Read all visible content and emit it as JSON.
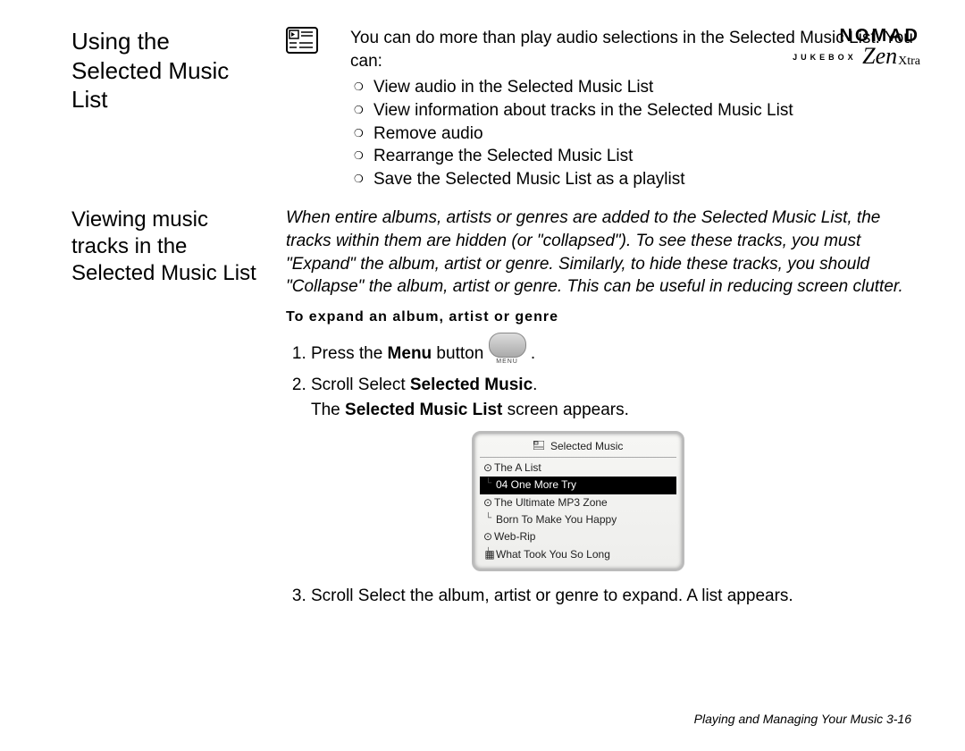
{
  "brand": {
    "nomad": "NOMAD",
    "jukebox": "JUKEBOX",
    "zen": "Zen",
    "xtra": "Xtra"
  },
  "section1": {
    "heading": "Using the Selected Music List",
    "intro": "You can do more than play audio selections in the Selected Music List. You can:",
    "bullets": [
      "View audio in the Selected Music List",
      "View information about tracks in the Selected Music List",
      "Remove audio",
      "Rearrange the Selected Music List",
      "Save the Selected Music List as a playlist"
    ]
  },
  "section2": {
    "heading": "Viewing music tracks in the Selected Music List",
    "paragraph": "When entire albums, artists or genres are added to the Selected Music List, the tracks within them are hidden (or \"collapsed\"). To see these tracks, you must \"Expand\" the album, artist or genre. Similarly, to hide these tracks, you should \"Collapse\" the album, artist or genre. This can be useful in reducing screen clutter.",
    "subhead": "To expand an album, artist or genre",
    "steps": {
      "s1_a": "Press the ",
      "s1_b": "Menu",
      "s1_c": " button ",
      "s1_d": ".",
      "s2_a": "Scroll Select ",
      "s2_b": "Selected Music",
      "s2_c": ".",
      "s2_line2_a": "The ",
      "s2_line2_b": "Selected Music List",
      "s2_line2_c": " screen appears.",
      "s3": "Scroll Select the album, artist or genre to expand. A list appears."
    },
    "menu_label": "MENU"
  },
  "device": {
    "title": "Selected Music",
    "items": [
      {
        "text": "The A List",
        "prefix": "⊙",
        "sub": false,
        "selected": false
      },
      {
        "text": "04 One More Try",
        "prefix": "",
        "sub": true,
        "selected": true
      },
      {
        "text": "The Ultimate MP3 Zone",
        "prefix": "⊙",
        "sub": false,
        "selected": false
      },
      {
        "text": "Born To Make You Happy",
        "prefix": "",
        "sub": true,
        "selected": false
      },
      {
        "text": "Web-Rip",
        "prefix": "⊙",
        "sub": false,
        "selected": false
      },
      {
        "text": "What Took You So Long",
        "prefix": "",
        "sub": true,
        "selected": false
      }
    ],
    "footer_icon": "▦"
  },
  "footer": "Playing and Managing Your Music 3-16"
}
